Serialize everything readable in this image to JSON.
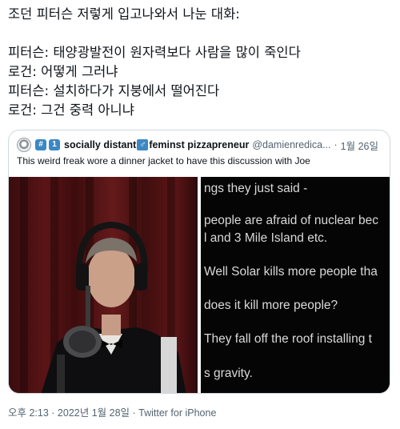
{
  "post": {
    "lines": [
      "조던 피터슨 저렇게 입고나와서 나눈 대화:",
      "",
      "피터슨: 태양광발전이 원자력보다 사람을 많이 죽인다",
      "로건: 어떻게 그러냐",
      "피터슨: 설치하다가 지붕에서 떨어진다",
      "로건: 그건 중력 아니냐"
    ]
  },
  "quote": {
    "emoji_prefix": [
      "#",
      "1"
    ],
    "display_name": "socially distant",
    "gender_symbol": "♂",
    "display_name_rest": "feminst pizzapreneur",
    "handle": "@damienredica...",
    "separator": "·",
    "date": "1월 26일",
    "text": "This weird freak wore a dinner jacket to have this discussion with Joe",
    "subtitles": [
      "ngs they just said -",
      "people are afraid of nuclear bec",
      "l and 3 Mile Island etc.",
      "Well Solar kills more people tha",
      "does it kill more people?",
      "They fall off the roof installing t",
      "s gravity."
    ]
  },
  "footer": {
    "timestamp": "오후 2:13 · 2022년 1월 28일 · Twitter for iPhone"
  },
  "colors": {
    "text": "#0f1419",
    "muted": "#536471",
    "border": "#cfd9de",
    "emoji_blue": "#3b88c3"
  }
}
